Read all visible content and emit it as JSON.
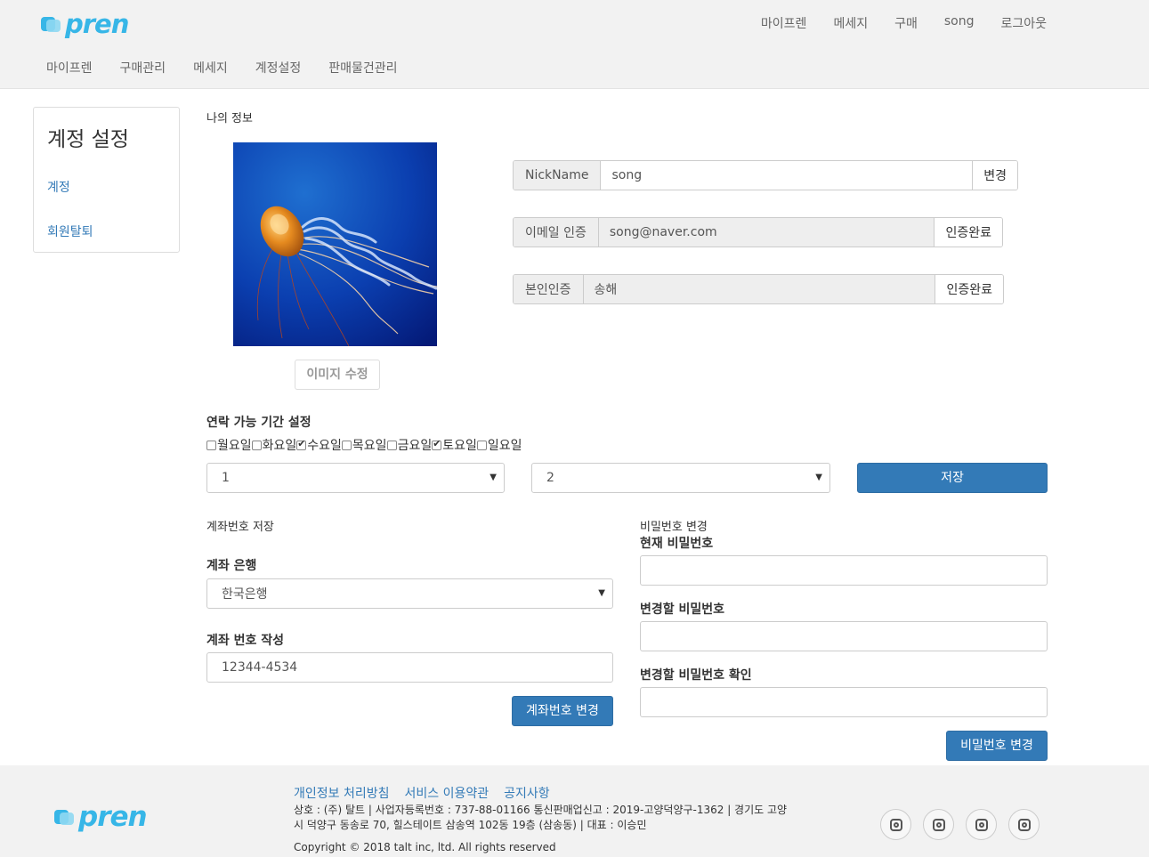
{
  "brand": {
    "logo_text": "pren",
    "logo_color": "#37b6e7"
  },
  "top_nav": [
    "마이프렌",
    "메세지",
    "구매",
    "song",
    "로그아웃"
  ],
  "sub_nav": [
    "마이프렌",
    "구매관리",
    "메세지",
    "계정설정",
    "판매물건관리"
  ],
  "sidebar": {
    "title": "계정 설정",
    "items": [
      {
        "label": "계정"
      },
      {
        "label": "회원탈퇴"
      }
    ]
  },
  "my_info": {
    "section_label": "나의 정보",
    "image_edit_button": "이미지 수정",
    "image_subject": "jellyfish-photo"
  },
  "profile_fields": {
    "nickname": {
      "label": "NickName",
      "value": "song",
      "button": "변경"
    },
    "email": {
      "label": "이메일 인증",
      "value": "song@naver.com",
      "button": "인증완료"
    },
    "identity": {
      "label": "본인인증",
      "value": "송해",
      "button": "인증완료"
    }
  },
  "contact": {
    "title": "연락 가능 기간 설정",
    "days": [
      {
        "label": "월요일",
        "checked": false
      },
      {
        "label": "화요일",
        "checked": false
      },
      {
        "label": "수요일",
        "checked": true
      },
      {
        "label": "목요일",
        "checked": false
      },
      {
        "label": "금요일",
        "checked": false
      },
      {
        "label": "토요일",
        "checked": true
      },
      {
        "label": "일요일",
        "checked": false
      }
    ],
    "from_value": "1",
    "to_value": "2",
    "save_button": "저장"
  },
  "account": {
    "section_label": "계좌번호 저장",
    "bank_label": "계좌 은행",
    "bank_value": "한국은행",
    "number_label": "계좌 번호 작성",
    "number_value": "12344-4534",
    "submit_button": "계좌번호 변경"
  },
  "password": {
    "section_label": "비밀번호 변경",
    "current_label": "현재 비밀번호",
    "new_label": "변경할 비밀번호",
    "confirm_label": "변경할 비밀번호 확인",
    "submit_button": "비밀번호 변경"
  },
  "footer": {
    "links": [
      "개인정보 처리방침",
      "서비스 이용약관",
      "공지사항"
    ],
    "company_line1": "상호 : (주) 탈트 | 사업자등록번호 : 737-88-01166 통신판매업신고 : 2019-고양덕양구-1362 | 경기도 고양",
    "company_line2": "시 덕양구 동송로 70, 힐스테이트 삼송역 102동 19층 (삼송동) | 대표 : 이승민",
    "copyright": "Copyright © 2018 talt inc, ltd. All rights reserved",
    "social_icons": [
      "instagram-icon",
      "instagram-icon",
      "instagram-icon",
      "instagram-icon"
    ]
  },
  "colors": {
    "primary": "#337ab7",
    "header_bg": "#f2f2f2",
    "link": "#337ab7"
  }
}
